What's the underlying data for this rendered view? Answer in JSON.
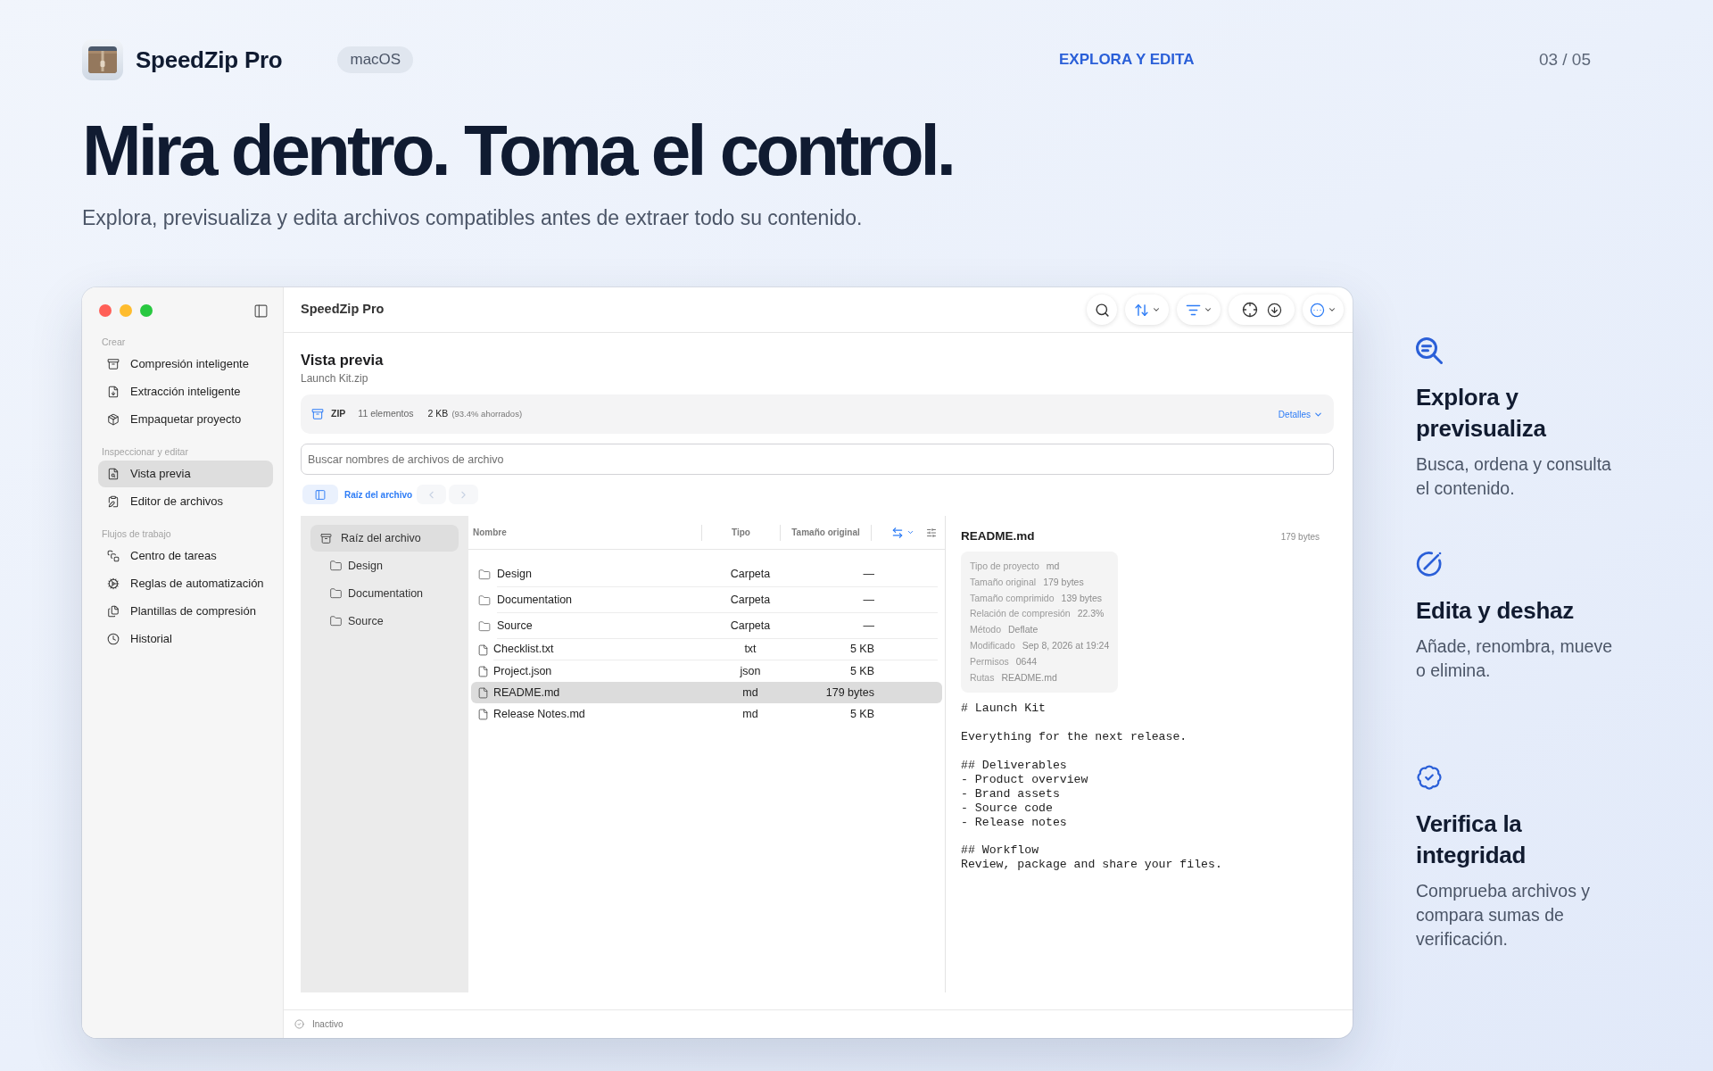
{
  "brand": {
    "name": "SpeedZip Pro",
    "platform": "macOS"
  },
  "section_label": "EXPLORA Y EDITA",
  "page_counter": "03 / 05",
  "headline": "Mira dentro. Toma el control.",
  "subtitle": "Explora, previsualiza y edita archivos compatibles antes de extraer todo su contenido.",
  "app_window": {
    "title": "SpeedZip Pro",
    "sidebar": {
      "sections": [
        {
          "title": "Crear",
          "items": [
            {
              "label": "Compresión inteligente",
              "selected": false
            },
            {
              "label": "Extracción inteligente",
              "selected": false
            },
            {
              "label": "Empaquetar proyecto",
              "selected": false
            }
          ]
        },
        {
          "title": "Inspeccionar y editar",
          "items": [
            {
              "label": "Vista previa",
              "selected": true
            },
            {
              "label": "Editor de archivos",
              "selected": false
            }
          ]
        },
        {
          "title": "Flujos de trabajo",
          "items": [
            {
              "label": "Centro de tareas",
              "selected": false
            },
            {
              "label": "Reglas de automatización",
              "selected": false
            },
            {
              "label": "Plantillas de compresión",
              "selected": false
            },
            {
              "label": "Historial",
              "selected": false
            }
          ]
        }
      ]
    },
    "view": {
      "title": "Vista previa",
      "subtitle": "Launch Kit.zip"
    },
    "archive_info": {
      "format": "ZIP",
      "item_count": "11 elementos",
      "size": "2 KB",
      "savings": "(93.4% ahorrados)",
      "details_button": "Detalles"
    },
    "search": {
      "placeholder": "Buscar nombres de archivos de archivo"
    },
    "breadcrumb": {
      "current": "Raíz del archivo",
      "back": {
        "disabled": true
      },
      "forward": {
        "disabled": true
      }
    },
    "tree": {
      "root": {
        "label": "Raíz del archivo",
        "selected": true,
        "children": [
          {
            "label": "Design",
            "selected": false
          },
          {
            "label": "Documentation",
            "selected": false
          },
          {
            "label": "Source",
            "selected": false
          }
        ]
      }
    },
    "file_list": {
      "columns": [
        "Nombre",
        "Tipo",
        "Tamaño original"
      ],
      "rows": [
        {
          "kind": "folder",
          "name": "Design",
          "type": "Carpeta",
          "size": "—",
          "selected": false
        },
        {
          "kind": "folder",
          "name": "Documentation",
          "type": "Carpeta",
          "size": "—",
          "selected": false
        },
        {
          "kind": "folder",
          "name": "Source",
          "type": "Carpeta",
          "size": "—",
          "selected": false
        },
        {
          "kind": "file",
          "name": "Checklist.txt",
          "type": "txt",
          "size": "5 KB",
          "selected": false
        },
        {
          "kind": "file",
          "name": "Project.json",
          "type": "json",
          "size": "5 KB",
          "selected": false
        },
        {
          "kind": "file",
          "name": "README.md",
          "type": "md",
          "size": "179 bytes",
          "selected": true
        },
        {
          "kind": "file",
          "name": "Release Notes.md",
          "type": "md",
          "size": "5 KB",
          "selected": false
        }
      ]
    },
    "preview": {
      "file_name": "README.md",
      "size": "179 bytes",
      "metadata": [
        {
          "label": "Tipo de proyecto",
          "value": "md"
        },
        {
          "label": "Tamaño original",
          "value": "179 bytes"
        },
        {
          "label": "Tamaño comprimido",
          "value": "139 bytes"
        },
        {
          "label": "Relación de compresión",
          "value": "22.3%"
        },
        {
          "label": "Método",
          "value": "Deflate"
        },
        {
          "label": "Modificado",
          "value": "Sep 8, 2026 at 19:24"
        },
        {
          "label": "Permisos",
          "value": "0644"
        },
        {
          "label": "Rutas",
          "value": "README.md"
        }
      ],
      "content": "# Launch Kit\n\nEverything for the next release.\n\n## Deliverables\n- Product overview\n- Brand assets\n- Source code\n- Release notes\n\n## Workflow\nReview, package and share your files."
    },
    "status_bar": {
      "text": "Inactivo"
    }
  },
  "features": [
    {
      "title": "Explora y previsualiza",
      "description": "Busca, ordena y consulta el contenido."
    },
    {
      "title": "Edita y deshaz",
      "description": "Añade, renombra, mueve o elimina."
    },
    {
      "title": "Verifica la integridad",
      "description": "Comprueba archivos y compara sumas de verificación."
    }
  ]
}
